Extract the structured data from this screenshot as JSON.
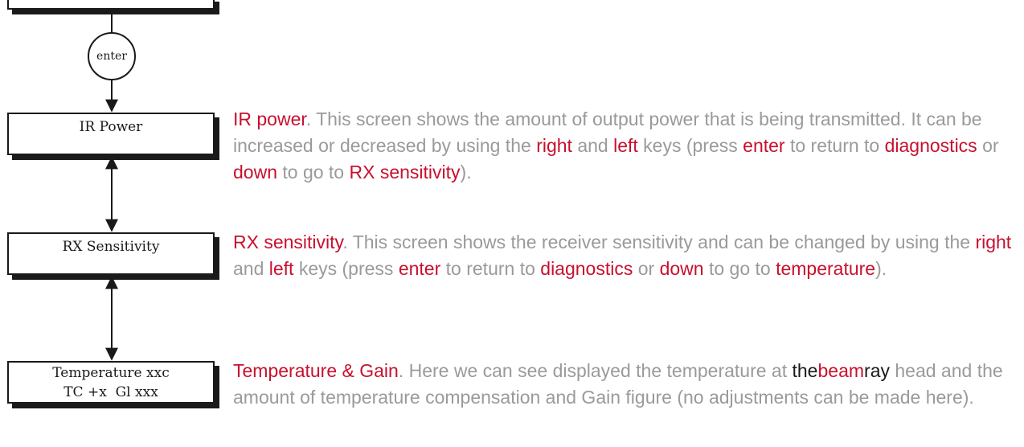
{
  "flow": {
    "enter_label": "enter",
    "boxes": {
      "ir_power": {
        "label": "IR Power"
      },
      "rx_sensitivity": {
        "label": "RX Sensitivity"
      },
      "temperature": {
        "line1": "Temperature xxc",
        "line2": "TC +x  Gl xxx"
      }
    }
  },
  "descriptions": {
    "ir_power": {
      "title": "IR power",
      "t1": ". This screen shows the amount of output power that is being transmitted. It can be increased or decreased by using the ",
      "k_right": "right",
      "t2": " and ",
      "k_left": "left",
      "t3": " keys (press ",
      "k_enter": "enter",
      "t4": " to return to ",
      "k_diagnostics": "diagnostics",
      "t5": " or ",
      "k_down": "down",
      "t6": " to go to ",
      "k_next": "RX sensitivity",
      "t7": ")."
    },
    "rx_sensitivity": {
      "title": "RX sensitivity",
      "t1": ". This screen shows the receiver sensitivity and can be changed by using the ",
      "k_right": "right",
      "t2": " and ",
      "k_left": "left",
      "t3": " keys (press ",
      "k_enter": "enter",
      "t4": " to return to ",
      "k_diagnostics": "diagnostics",
      "t5": " or ",
      "k_down": "down",
      "t6": " to go to ",
      "k_next": "temperature",
      "t7": ")."
    },
    "temperature": {
      "title": "Temperature & Gain",
      "t1": ". Here we can see displayed the temperature at ",
      "brand_the": "the",
      "brand_beam": "beam",
      "brand_ray": "ray",
      "t2": " head and the amount of temperature compensation and Gain figure (no adjustments can be made here)."
    }
  },
  "colors": {
    "highlight": "#c8102e",
    "body_text": "#9a9a9a",
    "outline": "#1a1a1a"
  }
}
